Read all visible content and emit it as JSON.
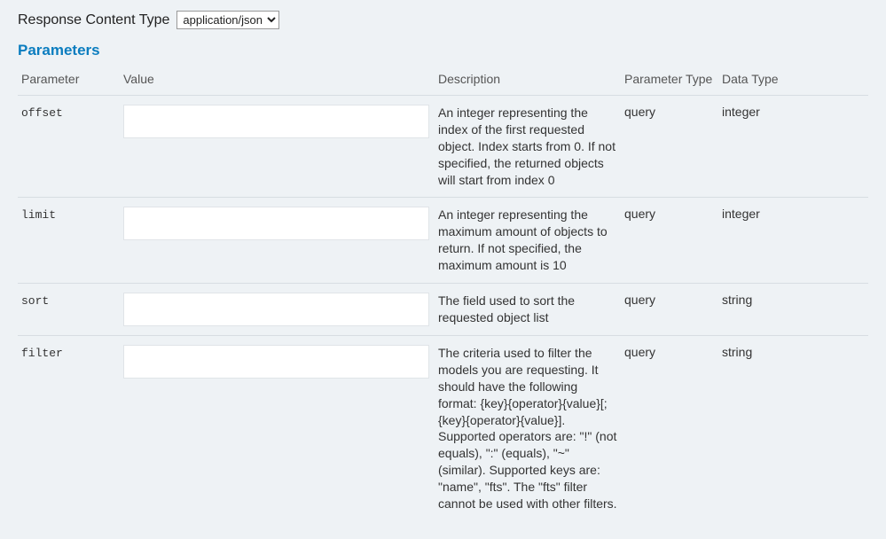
{
  "responseContentType": {
    "label": "Response Content Type",
    "selected": "application/json",
    "options": [
      "application/json"
    ]
  },
  "parameters": {
    "title": "Parameters",
    "headers": {
      "parameter": "Parameter",
      "value": "Value",
      "description": "Description",
      "parameterType": "Parameter Type",
      "dataType": "Data Type"
    },
    "rows": [
      {
        "name": "offset",
        "value": "",
        "description": "An integer representing the index of the first requested object. Index starts from 0. If not specified, the returned objects will start from index 0",
        "parameterType": "query",
        "dataType": "integer"
      },
      {
        "name": "limit",
        "value": "",
        "description": "An integer representing the maximum amount of objects to return. If not specified, the maximum amount is 10",
        "parameterType": "query",
        "dataType": "integer"
      },
      {
        "name": "sort",
        "value": "",
        "description": "The field used to sort the requested object list",
        "parameterType": "query",
        "dataType": "string"
      },
      {
        "name": "filter",
        "value": "",
        "description": "The criteria used to filter the models you are requesting. It should have the following format: {key}{operator}{value}[;{key}{operator}{value}]. Supported operators are: \"!\" (not equals), \":\" (equals), \"~\" (similar). Supported keys are: \"name\", \"fts\". The \"fts\" filter cannot be used with other filters.",
        "parameterType": "query",
        "dataType": "string"
      }
    ]
  }
}
